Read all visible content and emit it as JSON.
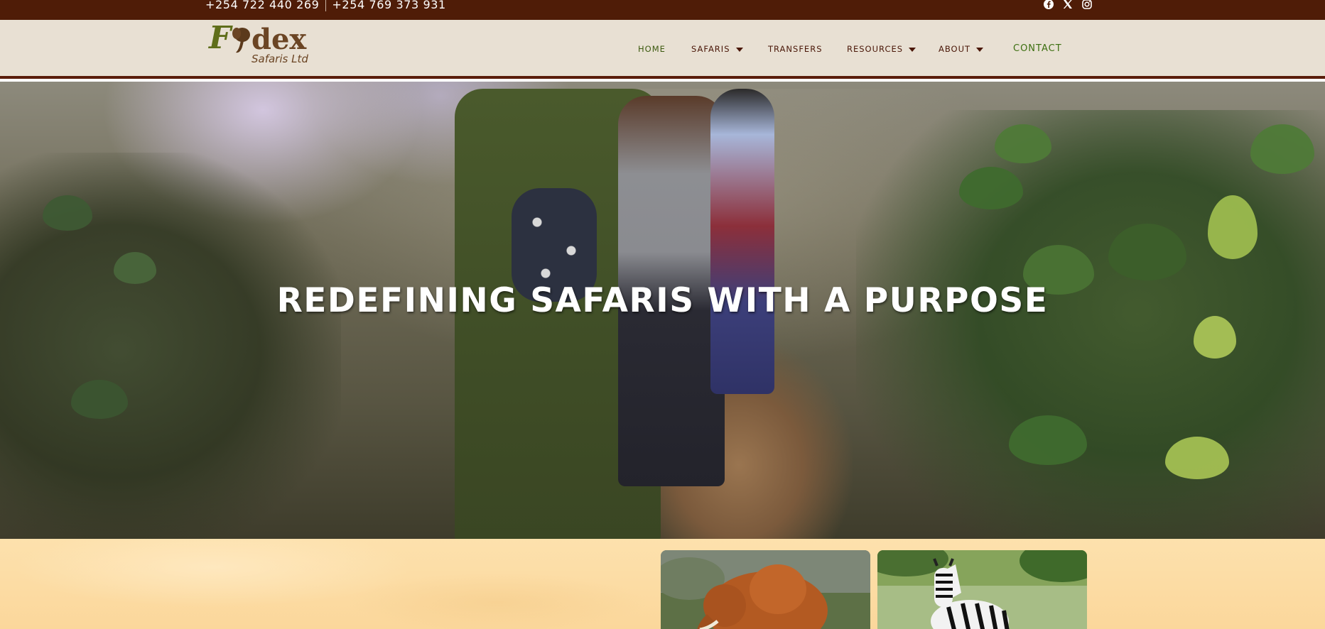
{
  "topbar": {
    "phone_1": "+254 722 440 269",
    "phone_2": "+254 769 373 931",
    "social": [
      "facebook-icon",
      "x-icon",
      "instagram-icon"
    ]
  },
  "header": {
    "logo": {
      "text_main": "Fidex",
      "text_sub": "Safaris Ltd"
    },
    "nav": [
      {
        "label": "HOME",
        "dropdown": false
      },
      {
        "label": "SAFARIS",
        "dropdown": true
      },
      {
        "label": "TRANSFERS",
        "dropdown": false
      },
      {
        "label": "RESOURCES",
        "dropdown": true
      },
      {
        "label": "ABOUT",
        "dropdown": true
      },
      {
        "label": "CONTACT",
        "dropdown": false
      }
    ]
  },
  "hero": {
    "heading": "REDEFINING SAFARIS WITH A PURPOSE"
  },
  "cards": [
    {
      "animal": "elephant"
    },
    {
      "animal": "zebra"
    }
  ],
  "colors": {
    "topbar_bg": "#4f1c07",
    "header_bg": "#e8e0d3",
    "nav_text": "#4a1708",
    "nav_home": "#3c5a0f",
    "contact": "#3c6f10",
    "below_bg": "#fbd79b"
  }
}
